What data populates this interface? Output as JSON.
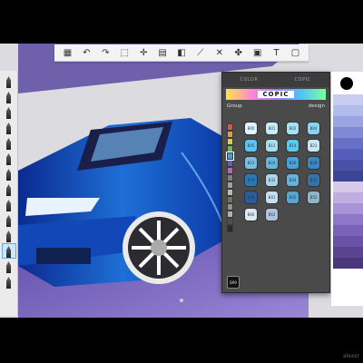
{
  "toolbar": {
    "icons": [
      "grid-icon",
      "undo-icon",
      "redo-icon",
      "select-icon",
      "transform-icon",
      "layers-icon",
      "ruler-icon",
      "crop-icon",
      "symmetry-icon",
      "brush-icon",
      "image-icon",
      "text-icon",
      "window-icon"
    ],
    "glyphs": [
      "▦",
      "↶",
      "↷",
      "⬚",
      "✛",
      "▤",
      "◧",
      "⟋",
      "✕",
      "✤",
      "▣",
      "T",
      "▢"
    ]
  },
  "color_panel": {
    "tabs": [
      "COLOR",
      "COPIC"
    ],
    "active_tab": "COPIC",
    "banner": "COPIC",
    "group_label": "Group",
    "design_label": "design",
    "group_colors": [
      "#e05050",
      "#e0a040",
      "#d8d040",
      "#60c050",
      "#40a0d0",
      "#6060c0",
      "#c060c0",
      "#808080",
      "#a0a0a0",
      "#c8b8a0",
      "#707070",
      "#909090",
      "#b0b0b0",
      "#505050",
      "#2a2a2a"
    ],
    "swatches": [
      {
        "code": "B00",
        "color": "#dff4fb"
      },
      {
        "code": "B01",
        "color": "#c8ecf8"
      },
      {
        "code": "B02",
        "color": "#a9e1f4"
      },
      {
        "code": "B04",
        "color": "#88d3ee"
      },
      {
        "code": "B05",
        "color": "#5fc3ec"
      },
      {
        "code": "B12",
        "color": "#a7dff2"
      },
      {
        "code": "B14",
        "color": "#62c6ea"
      },
      {
        "code": "B21",
        "color": "#c9e5f3"
      },
      {
        "code": "B23",
        "color": "#7bbde0"
      },
      {
        "code": "B24",
        "color": "#64b7e1"
      },
      {
        "code": "B26",
        "color": "#4aa2d6"
      },
      {
        "code": "B28",
        "color": "#3a86c2"
      },
      {
        "code": "B29",
        "color": "#2a78b8"
      },
      {
        "code": "B32",
        "color": "#abd6ea"
      },
      {
        "code": "B34",
        "color": "#6ab1d9"
      },
      {
        "code": "B37",
        "color": "#3574a9"
      },
      {
        "code": "B39",
        "color": "#2d5c9c"
      },
      {
        "code": "B41",
        "color": "#c5dff0"
      },
      {
        "code": "B45",
        "color": "#5aa6d2"
      },
      {
        "code": "B52",
        "color": "#8fb6c7"
      },
      {
        "code": "B60",
        "color": "#dde8f3"
      },
      {
        "code": "B63",
        "color": "#aec3de"
      }
    ],
    "selected_label": "B99"
  },
  "palette": {
    "colors": [
      "#c8cdf0",
      "#b3bbea",
      "#9aa4e0",
      "#7f89d4",
      "#6670c6",
      "#555fba",
      "#4851a8",
      "#3b4495",
      "#d6c9ec",
      "#c0aee2",
      "#a992d6",
      "#8e76c8",
      "#7a62b8",
      "#6a52a6",
      "#5a4490",
      "#4a377c"
    ]
  },
  "watermark": "alexsr"
}
